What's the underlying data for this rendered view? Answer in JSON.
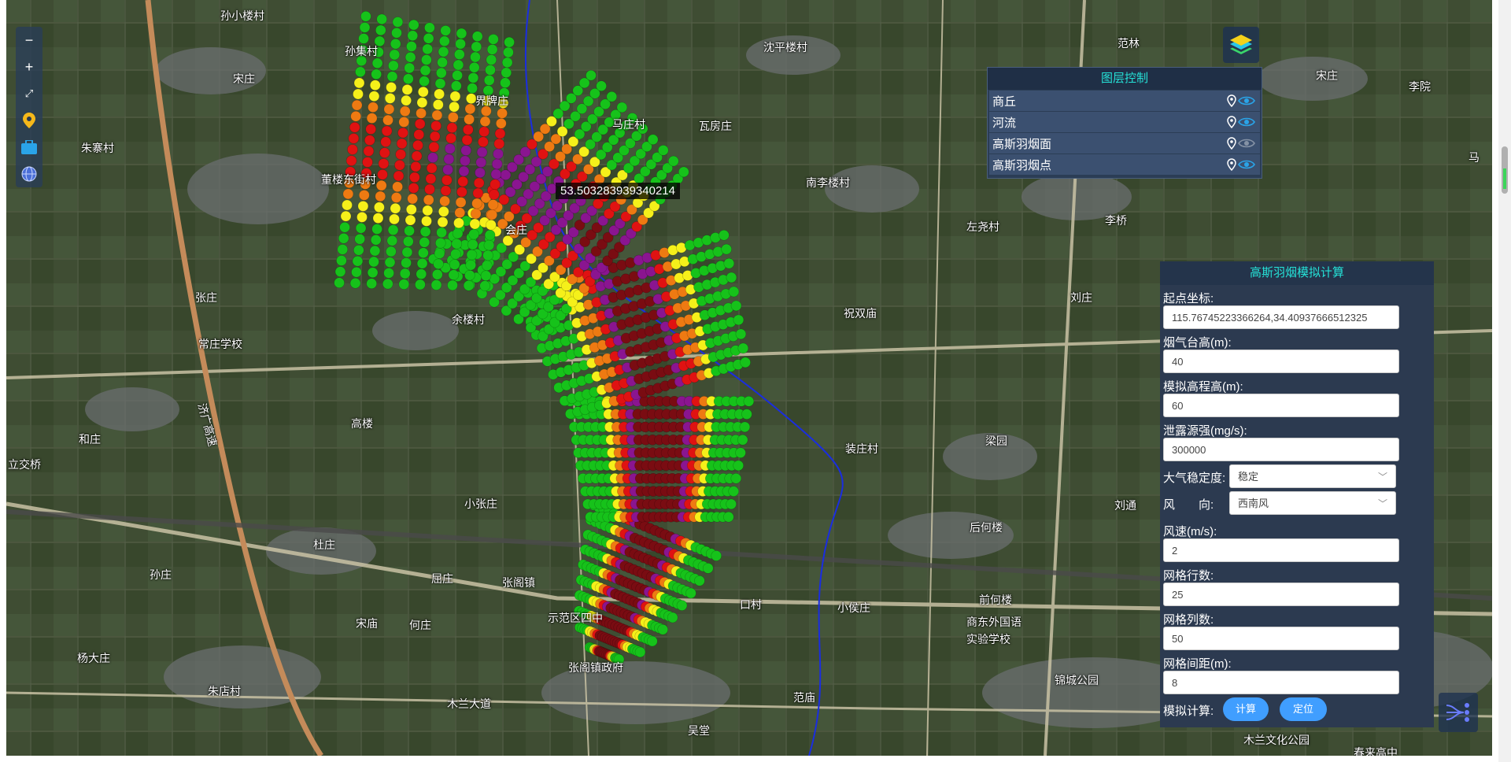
{
  "tooltip": "53.50328393934021​4",
  "map_controls": [
    {
      "name": "zoom-out-button",
      "glyph": "−"
    },
    {
      "name": "zoom-in-button",
      "glyph": "+"
    },
    {
      "name": "fullscreen-button",
      "glyph": "⛶"
    },
    {
      "name": "location-button",
      "icon": "pin-icon"
    },
    {
      "name": "toolbox-button",
      "icon": "briefcase-icon"
    },
    {
      "name": "globe-button",
      "icon": "globe-icon"
    }
  ],
  "layer_panel": {
    "title": "图层控制",
    "layers": [
      {
        "label": "商丘",
        "visible": true
      },
      {
        "label": "河流",
        "visible": true
      },
      {
        "label": "高斯羽烟面",
        "visible": false
      },
      {
        "label": "高斯羽烟点",
        "visible": true
      }
    ]
  },
  "calc_panel": {
    "title": "高斯羽烟模拟计算",
    "start_label": "起点坐标:",
    "start_value": "115.76745223366264,34.40937666512325",
    "stack_label": "烟气台高(m):",
    "stack_value": "40",
    "sim_height_label": "模拟高程高(m):",
    "sim_height_value": "60",
    "source_label": "泄露源强(mg/s):",
    "source_value": "300000",
    "stability_label": "大气稳定度:",
    "stability_value": "稳定",
    "wind_dir_label": "风　　向:",
    "wind_dir_value": "西南风",
    "wind_speed_label": "风速(m/s):",
    "wind_speed_value": "2",
    "rows_label": "网格行数:",
    "rows_value": "25",
    "cols_label": "网格列数:",
    "cols_value": "50",
    "spacing_label": "网格间距(m):",
    "spacing_value": "8",
    "compute_label": "模拟计算:",
    "compute_button": "计算",
    "locate_button": "定位"
  },
  "places": [
    {
      "t": "孙小楼村"
    },
    {
      "t": "孙集村"
    },
    {
      "t": "宋庄"
    },
    {
      "t": "朱寨村"
    },
    {
      "t": "董楼东街村"
    },
    {
      "t": "界牌庄"
    },
    {
      "t": "马庄村"
    },
    {
      "t": "瓦房庄"
    },
    {
      "t": "沈平楼村"
    },
    {
      "t": "范林"
    },
    {
      "t": "宋庄"
    },
    {
      "t": "李院"
    },
    {
      "t": "南李楼村"
    },
    {
      "t": "左尧村"
    },
    {
      "t": "李桥"
    },
    {
      "t": "会庄"
    },
    {
      "t": "张庄"
    },
    {
      "t": "常庄学校"
    },
    {
      "t": "余楼村"
    },
    {
      "t": "祝双庙"
    },
    {
      "t": "刘庄"
    },
    {
      "t": "孟庄"
    },
    {
      "t": "高楼"
    },
    {
      "t": "和庄"
    },
    {
      "t": "立交桥"
    },
    {
      "t": "梁园"
    },
    {
      "t": "装庄村"
    },
    {
      "t": "刘通"
    },
    {
      "t": "小张庄"
    },
    {
      "t": "后何楼"
    },
    {
      "t": "杜庄"
    },
    {
      "t": "孙庄"
    },
    {
      "t": "屈庄"
    },
    {
      "t": "张阁镇"
    },
    {
      "t": "示范区四中"
    },
    {
      "t": "宋庙"
    },
    {
      "t": "何庄"
    },
    {
      "t": "口村"
    },
    {
      "t": "小侯庄"
    },
    {
      "t": "前何楼"
    },
    {
      "t": "商东外国语"
    },
    {
      "t": "实验学校"
    },
    {
      "t": "杨大庄"
    },
    {
      "t": "张阁镇政府"
    },
    {
      "t": "朱店村"
    },
    {
      "t": "木兰大道"
    },
    {
      "t": "范庙"
    },
    {
      "t": "锦城公园"
    },
    {
      "t": "吴堂"
    },
    {
      "t": "木兰文化公园"
    },
    {
      "t": "春来高中"
    },
    {
      "t": "马"
    },
    {
      "t": "济广高速"
    }
  ],
  "colors": {
    "green": "#16c21a",
    "yellow": "#f5f01a",
    "orange": "#ee7a12",
    "red": "#e01212",
    "purple": "#8a1590",
    "darkred": "#7a0c12",
    "accent": "#25e1d7",
    "button": "#409eff"
  },
  "plume": {
    "rows": 25,
    "cols": 50
  }
}
